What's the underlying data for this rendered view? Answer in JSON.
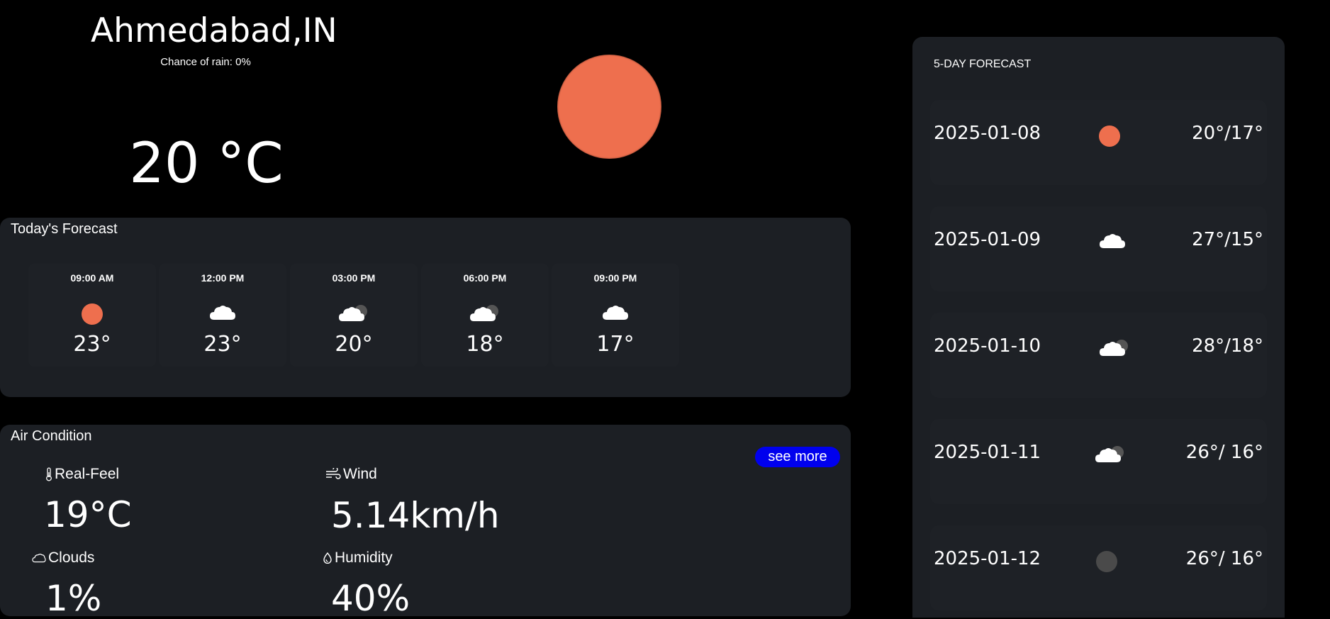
{
  "location": {
    "city": "Ahmedabad,IN",
    "rain_label": "Chance of rain: 0%"
  },
  "current": {
    "temp": "20 °C",
    "icon": "sun-icon"
  },
  "today": {
    "title": "Today's Forecast",
    "hours": [
      {
        "time": "09:00 AM",
        "icon": "sun-icon",
        "temp": "23°"
      },
      {
        "time": "12:00 PM",
        "icon": "cloud-icon",
        "temp": "23°"
      },
      {
        "time": "03:00 PM",
        "icon": "cloud-moon-icon",
        "temp": "20°"
      },
      {
        "time": "06:00 PM",
        "icon": "cloud-moon-icon",
        "temp": "18°"
      },
      {
        "time": "09:00 PM",
        "icon": "cloud-icon",
        "temp": "17°"
      }
    ]
  },
  "air": {
    "title": "Air Condition",
    "see_more": "see more",
    "real_feel": {
      "label": "Real-Feel",
      "value": "19°C",
      "icon": "thermometer-icon"
    },
    "wind": {
      "label": "Wind",
      "value": "5.14km/h",
      "icon": "wind-icon"
    },
    "clouds": {
      "label": "Clouds",
      "value": "1%",
      "icon": "cloud-outline-icon"
    },
    "humidity": {
      "label": "Humidity",
      "value": "40%",
      "icon": "droplet-icon"
    }
  },
  "forecast5": {
    "title": "5-DAY FORECAST",
    "days": [
      {
        "date": "2025-01-08",
        "icon": "sun-icon",
        "range": "20°/17°"
      },
      {
        "date": "2025-01-09",
        "icon": "cloud-icon",
        "range": "27°/15°"
      },
      {
        "date": "2025-01-10",
        "icon": "cloud-moon-icon",
        "range": "28°/18°"
      },
      {
        "date": "2025-01-11",
        "icon": "cloud-moon-icon",
        "range": "26°/ 16°"
      },
      {
        "date": "2025-01-12",
        "icon": "moon-icon",
        "range": "26°/ 16°"
      }
    ]
  },
  "colors": {
    "background": "#000000",
    "panel": "#1c1f24",
    "sun": "#ee6f4e",
    "button": "#0000ee",
    "text": "#ffffff"
  }
}
